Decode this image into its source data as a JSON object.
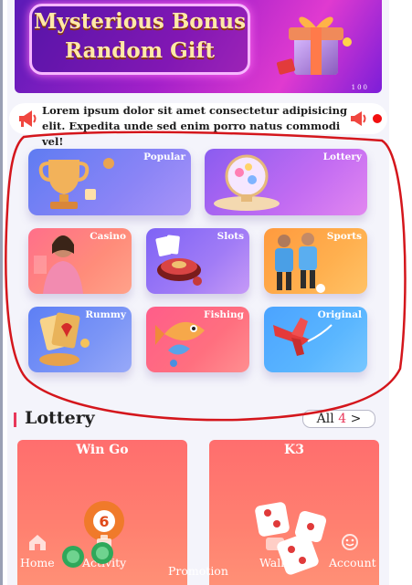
{
  "banner": {
    "line1": "Mysterious Bonus",
    "line2": "Random Gift",
    "slide_indicator": "100"
  },
  "notice": {
    "text": "Lorem ipsum dolor sit amet consectetur adipisicing elit. Expedita unde sed enim porro natus commodi vel!"
  },
  "categories": [
    {
      "label": "Popular"
    },
    {
      "label": "Lottery"
    },
    {
      "label": "Casino"
    },
    {
      "label": "Slots"
    },
    {
      "label": "Sports"
    },
    {
      "label": "Rummy"
    },
    {
      "label": "Fishing"
    },
    {
      "label": "Original"
    }
  ],
  "section": {
    "title": "Lottery",
    "all_label": "All",
    "all_count": "4",
    "all_arrow": ">"
  },
  "games": [
    {
      "title": "Win Go"
    },
    {
      "title": "K3"
    }
  ],
  "bottom_nav": [
    {
      "label": "Home",
      "icon": "home-icon"
    },
    {
      "label": "Activity",
      "icon": "activity-icon"
    },
    {
      "label": "Promotion",
      "icon": "promotion-icon"
    },
    {
      "label": "Wallet",
      "icon": "wallet-icon"
    },
    {
      "label": "Account",
      "icon": "account-icon"
    }
  ],
  "colors": {
    "accent": "#e8375a",
    "annotation": "#d4161c"
  }
}
